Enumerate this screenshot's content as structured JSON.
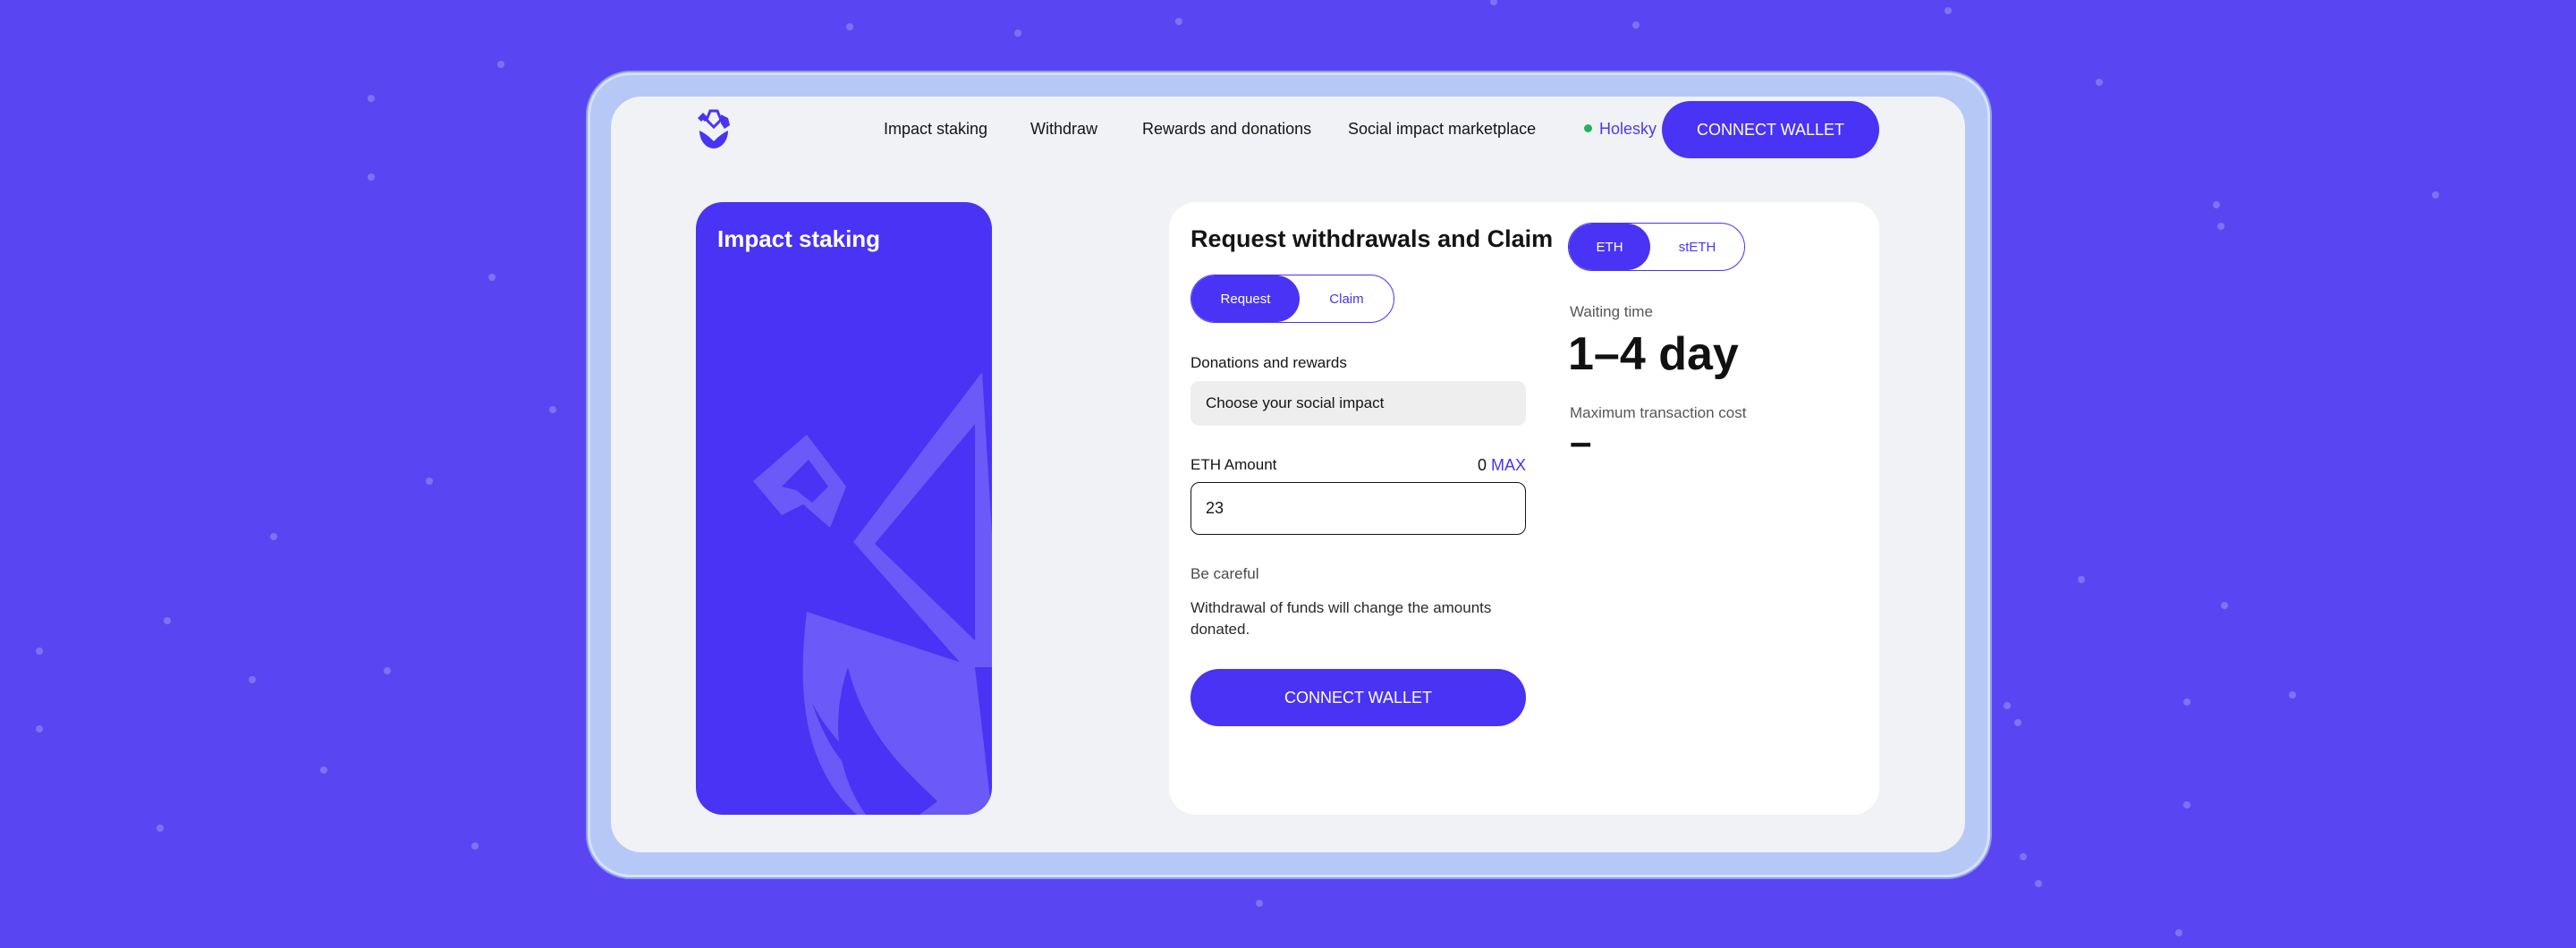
{
  "header": {
    "nav": [
      {
        "label": "Impact staking"
      },
      {
        "label": "Withdraw"
      },
      {
        "label": "Rewards and donations"
      },
      {
        "label": "Social impact marketplace"
      }
    ],
    "network": "Holesky",
    "connect_label": "CONNECT WALLET"
  },
  "left_card": {
    "title": "Impact staking"
  },
  "panel": {
    "title": "Request withdrawals and Claim",
    "mode_tabs": [
      {
        "label": "Request",
        "active": true
      },
      {
        "label": "Claim",
        "active": false
      }
    ],
    "token_tabs": [
      {
        "label": "ETH",
        "active": true
      },
      {
        "label": "stETH",
        "active": false
      }
    ],
    "donations_label": "Donations and rewards",
    "social_impact_select": "Choose your social impact",
    "amount_label": "ETH Amount",
    "balance": "0",
    "max_label": "MAX",
    "amount_value": "23",
    "careful_title": "Be careful",
    "careful_text": "Withdrawal of funds will change the amounts donated.",
    "connect_label": "CONNECT WALLET",
    "waiting_label": "Waiting time",
    "waiting_value": "1–4 day",
    "cost_label": "Maximum transaction cost",
    "cost_value": "–"
  },
  "colors": {
    "background": "#5946f2",
    "primary": "#4933f5",
    "network_dot": "#22b35a"
  }
}
